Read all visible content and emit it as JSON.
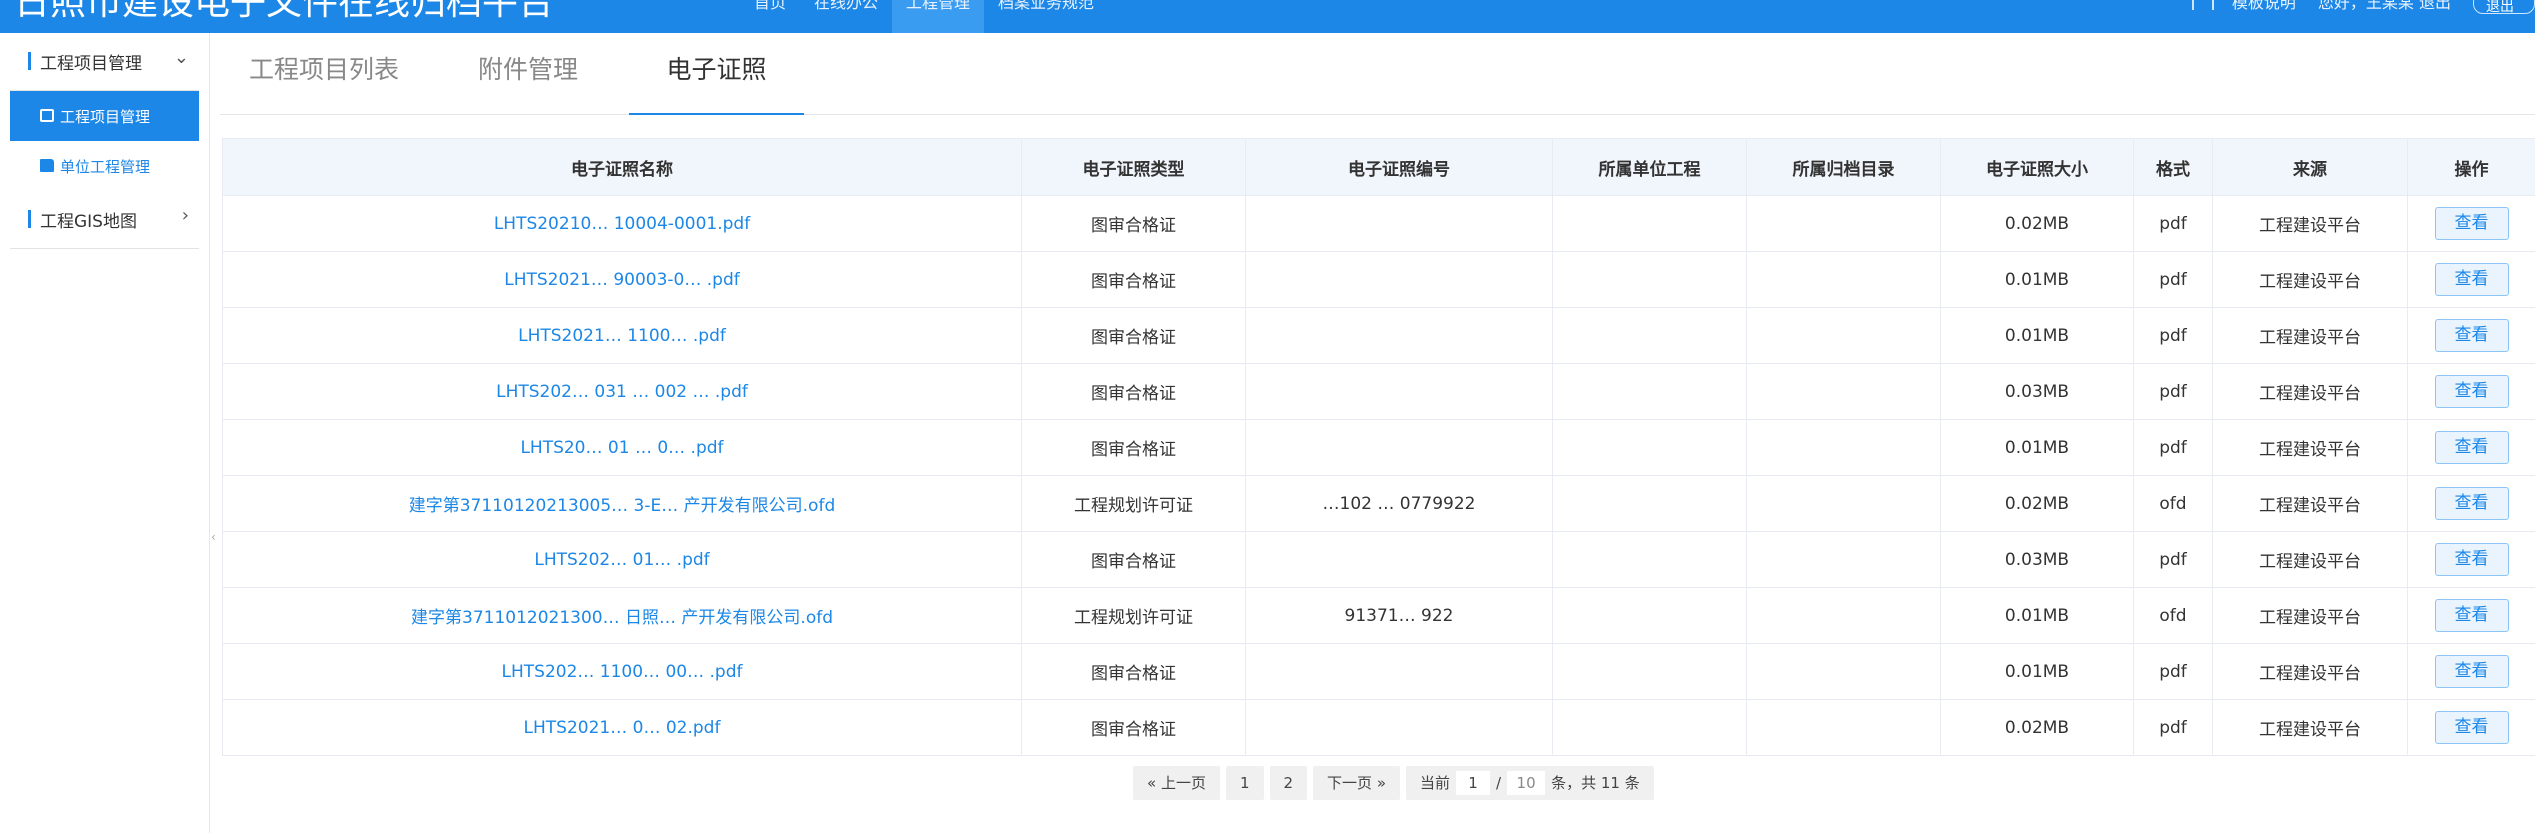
{
  "header": {
    "site_title": "日照市建设电子文件在线归档平台",
    "nav": [
      "首页",
      "在线办公",
      "工程管理",
      "档案业务规范"
    ],
    "right": {
      "user_text": "模板说明",
      "unit_text": "您好，王某某 退出",
      "logout": "退出"
    }
  },
  "sidebar": {
    "group1": {
      "label": "工程项目管理"
    },
    "items": [
      {
        "label": "工程项目管理"
      },
      {
        "label": "单位工程管理"
      }
    ],
    "group2": {
      "label": "工程GIS地图"
    }
  },
  "tabs": [
    "工程项目列表",
    "附件管理",
    "电子证照"
  ],
  "table": {
    "columns": [
      "电子证照名称",
      "电子证照类型",
      "电子证照编号",
      "所属单位工程",
      "所属归档目录",
      "电子证照大小",
      "格式",
      "来源",
      "操作"
    ],
    "action_label": "查看",
    "rows": [
      {
        "name": "LHTS20210… 10004-0001.pdf",
        "type": "图审合格证",
        "code": "",
        "unit": "",
        "dir": "",
        "size": "0.02MB",
        "fmt": "pdf",
        "src": "工程建设平台"
      },
      {
        "name": "LHTS2021… 90003-0… .pdf",
        "type": "图审合格证",
        "code": "",
        "unit": "",
        "dir": "",
        "size": "0.01MB",
        "fmt": "pdf",
        "src": "工程建设平台"
      },
      {
        "name": "LHTS2021… 1100… .pdf",
        "type": "图审合格证",
        "code": "",
        "unit": "",
        "dir": "",
        "size": "0.01MB",
        "fmt": "pdf",
        "src": "工程建设平台"
      },
      {
        "name": "LHTS202… 031 … 002 … .pdf",
        "type": "图审合格证",
        "code": "",
        "unit": "",
        "dir": "",
        "size": "0.03MB",
        "fmt": "pdf",
        "src": "工程建设平台"
      },
      {
        "name": "LHTS20… 01 … 0… .pdf",
        "type": "图审合格证",
        "code": "",
        "unit": "",
        "dir": "",
        "size": "0.01MB",
        "fmt": "pdf",
        "src": "工程建设平台"
      },
      {
        "name": "建字第37110120213005… 3-E… 产开发有限公司.ofd",
        "type": "工程规划许可证",
        "code": "…102 … 0779922",
        "unit": "",
        "dir": "",
        "size": "0.02MB",
        "fmt": "ofd",
        "src": "工程建设平台"
      },
      {
        "name": "LHTS202… 01… .pdf",
        "type": "图审合格证",
        "code": "",
        "unit": "",
        "dir": "",
        "size": "0.03MB",
        "fmt": "pdf",
        "src": "工程建设平台"
      },
      {
        "name": "建字第3711012021300… 日照… 产开发有限公司.ofd",
        "type": "工程规划许可证",
        "code": "91371… 922",
        "unit": "",
        "dir": "",
        "size": "0.01MB",
        "fmt": "ofd",
        "src": "工程建设平台"
      },
      {
        "name": "LHTS202… 1100… 00… .pdf",
        "type": "图审合格证",
        "code": "",
        "unit": "",
        "dir": "",
        "size": "0.01MB",
        "fmt": "pdf",
        "src": "工程建设平台"
      },
      {
        "name": "LHTS2021… 0… 02.pdf",
        "type": "图审合格证",
        "code": "",
        "unit": "",
        "dir": "",
        "size": "0.02MB",
        "fmt": "pdf",
        "src": "工程建设平台"
      }
    ]
  },
  "pager": {
    "prev": "« 上一页",
    "pages": [
      "1",
      "2"
    ],
    "next": "下一页 »",
    "current_label": "当前",
    "current": "1",
    "sep": "/",
    "total_pages": "10",
    "suffix": "条，共 11 条"
  },
  "colors": {
    "primary": "#1c87e6",
    "header_bg": "#f1f6fc",
    "active_nav": "#3a9cf0"
  }
}
